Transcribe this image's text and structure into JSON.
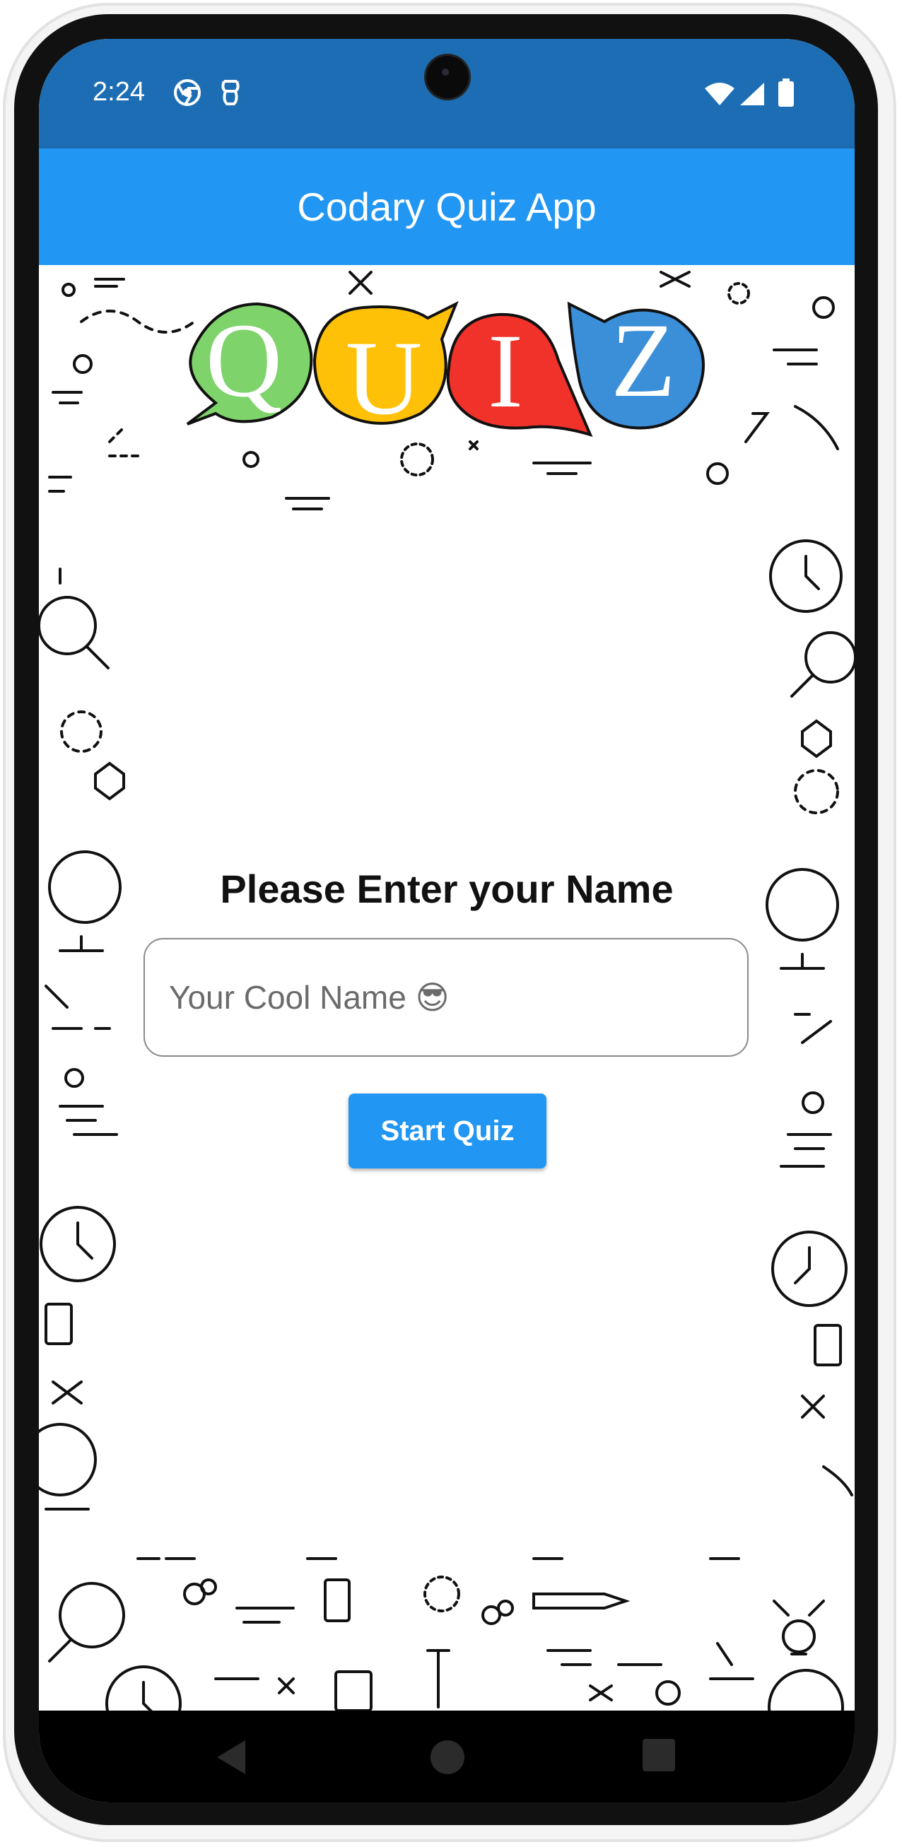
{
  "status_bar": {
    "time": "2:24",
    "left_icons": [
      "chrome-icon",
      "accessibility-icon"
    ],
    "right_icons": [
      "wifi-icon",
      "signal-icon",
      "battery-icon"
    ]
  },
  "app_bar": {
    "title": "Codary Quiz App"
  },
  "logo": {
    "letters": [
      "Q",
      "U",
      "I",
      "Z"
    ],
    "colors": [
      "#7ed36a",
      "#ffc107",
      "#f0322b",
      "#3b8ed8"
    ]
  },
  "form": {
    "prompt": "Please Enter your Name",
    "name_placeholder": "Your Cool Name 😎",
    "start_label": "Start Quiz"
  },
  "nav_bar": {
    "buttons": [
      "back-icon",
      "home-icon",
      "recents-icon"
    ]
  },
  "colors": {
    "status_bar": "#1c6db3",
    "app_bar": "#2196f3",
    "button": "#2196f3"
  }
}
